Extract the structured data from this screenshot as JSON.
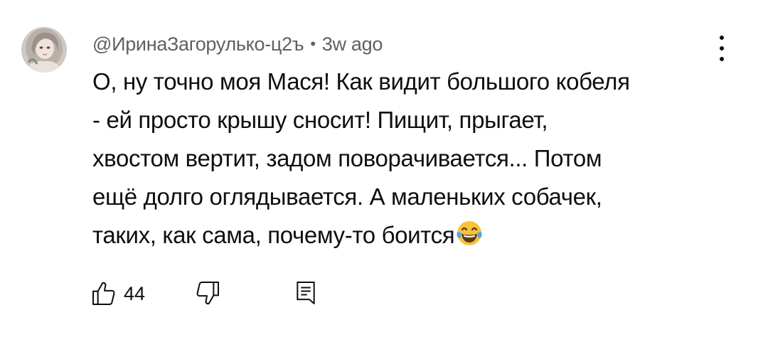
{
  "comment": {
    "author": "@ИринаЗагорулько-ц2ъ",
    "separator": "•",
    "time": "3w ago",
    "text_lines": [
      "О, ну точно моя Мася! Как видит большого кобеля",
      "- ей просто крышу сносит! Пищит, прыгает,",
      "хвостом вертит, задом поворачивается... Потом",
      "ещё долго оглядывается. А маленьких собачек,",
      "таких, как сама, почему-то боится"
    ],
    "emoji": "face-with-tears-of-joy-icon",
    "like_count": "44"
  },
  "icons": {
    "avatar": "avatar",
    "menu": "more-vertical-icon",
    "like": "thumbs-up-icon",
    "dislike": "thumbs-down-icon",
    "reply": "reply-icon"
  },
  "colors": {
    "text": "#0f0f0f",
    "secondary_text": "#606060",
    "background": "#ffffff",
    "emoji_yellow": "#f7c23c",
    "emoji_tear": "#4fa8e8"
  }
}
